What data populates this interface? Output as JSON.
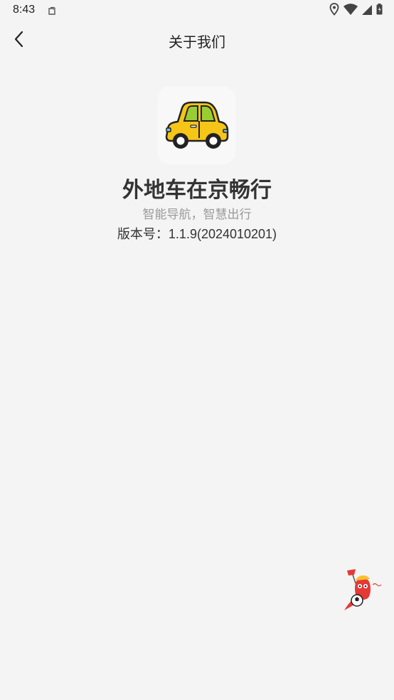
{
  "status_bar": {
    "time": "8:43",
    "icons": [
      "notification-icon",
      "location-icon",
      "wifi-icon",
      "signal-icon",
      "battery-icon"
    ]
  },
  "header": {
    "title": "关于我们",
    "back_icon": "chevron-left-icon"
  },
  "about": {
    "app_icon": "car-icon",
    "app_name": "外地车在京畅行",
    "slogan": "智能导航，智慧出行",
    "version_label": "版本号：",
    "version_value": "1.1.9(2024010201)"
  },
  "floating": {
    "mascot_icon": "mascot-soccer-icon"
  },
  "colors": {
    "background": "#f4f4f4",
    "car_body": "#f5c518",
    "car_window": "#9acd32",
    "text_primary": "#333333",
    "text_secondary": "#9a9a9a"
  }
}
